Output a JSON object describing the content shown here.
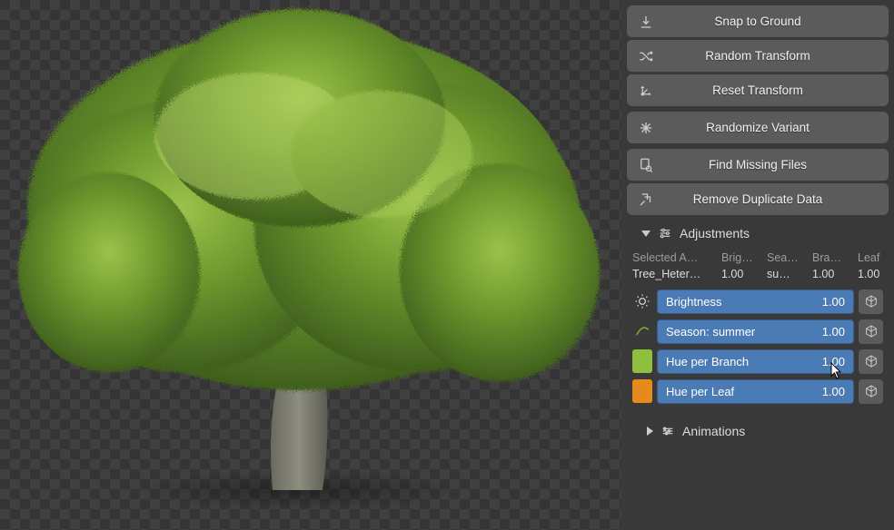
{
  "buttons": {
    "snap_to_ground": "Snap to Ground",
    "random_transform": "Random Transform",
    "reset_transform": "Reset Transform",
    "randomize_variant": "Randomize Variant",
    "find_missing_files": "Find Missing Files",
    "remove_duplicate_data": "Remove Duplicate Data"
  },
  "sections": {
    "adjustments": "Adjustments",
    "animations": "Animations"
  },
  "adjust_table": {
    "headers": {
      "asset": "Selected A…",
      "brig": "Brig…",
      "sea": "Sea…",
      "bra": "Bra…",
      "leaf": "Leaf"
    },
    "row": {
      "asset": "Tree_Heter…",
      "brig": "1.00",
      "sea": "su…",
      "bra": "1.00",
      "leaf": "1.00"
    }
  },
  "sliders": {
    "brightness": {
      "label": "Brightness",
      "value": "1.00",
      "swatch": null
    },
    "season": {
      "label": "Season: summer",
      "value": "1.00",
      "swatch": null
    },
    "hue_branch": {
      "label": "Hue per Branch",
      "value": "1.00",
      "swatch": "#8fbf3f"
    },
    "hue_leaf": {
      "label": "Hue per Leaf",
      "value": "1.00",
      "swatch": "#e78a1e"
    }
  },
  "icons": {
    "snap": "download-icon",
    "random_transform": "shuffle-icon",
    "reset_transform": "axes-reset-icon",
    "randomize_variant": "asterisk-icon",
    "find_missing": "search-file-icon",
    "remove_duplicate": "dedupe-icon",
    "adjustments": "sliders-icon",
    "animations": "animation-icon",
    "brightness": "sun-icon",
    "season": "leaf-arc-icon",
    "cube": "apply-cube-icon"
  }
}
